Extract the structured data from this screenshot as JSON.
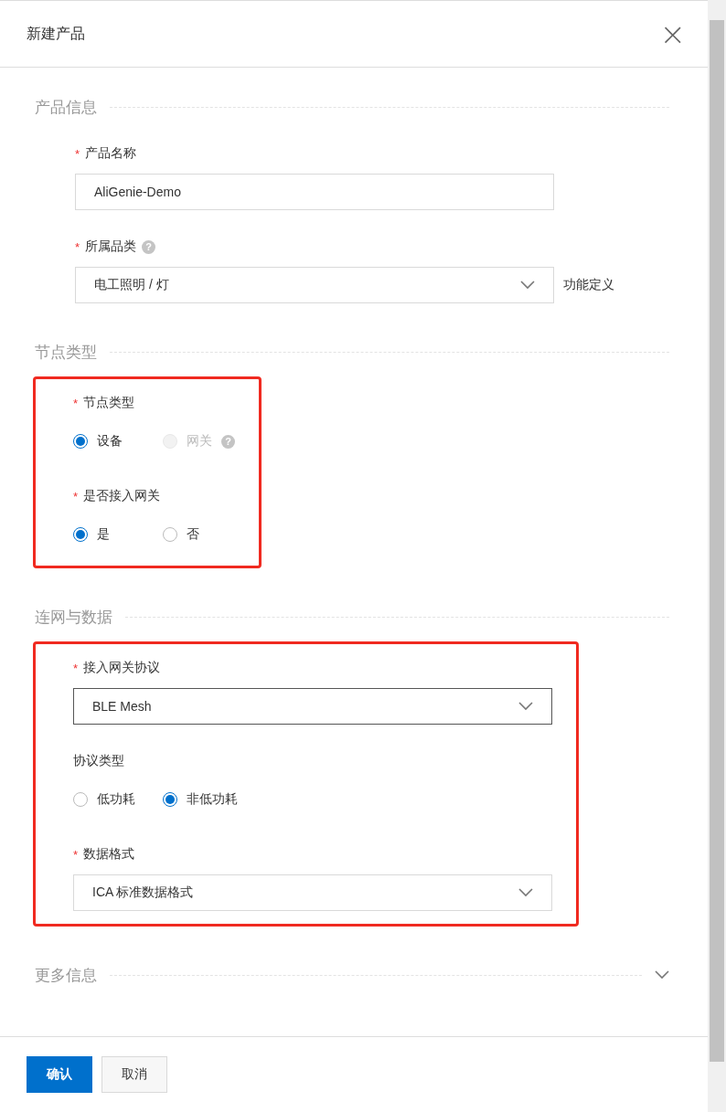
{
  "dialog": {
    "title": "新建产品",
    "close": "×"
  },
  "sections": [
    {
      "title": "产品信息",
      "kind": "group",
      "groups": [
        {
          "highlighted": false,
          "fields": [
            {
              "kind": "input",
              "label": "产品名称",
              "required_mark": "*",
              "value": "AliGenie-Demo"
            },
            {
              "kind": "select",
              "label": "所属品类",
              "required_mark": "*",
              "help": "?",
              "value": "电工照明 / 灯",
              "active": false,
              "link": "功能定义"
            }
          ]
        }
      ]
    },
    {
      "title": "节点类型",
      "kind": "group",
      "groups": [
        {
          "highlighted": true,
          "fields": [
            {
              "kind": "radio",
              "label": "节点类型",
              "required_mark": "*",
              "options": [
                {
                  "label": "设备",
                  "selected": true,
                  "disabled": false
                },
                {
                  "label": "网关",
                  "selected": false,
                  "disabled": true,
                  "help": "?"
                }
              ]
            },
            {
              "kind": "radio",
              "label": "是否接入网关",
              "required_mark": "*",
              "options": [
                {
                  "label": "是",
                  "selected": true,
                  "disabled": false
                },
                {
                  "label": "否",
                  "selected": false,
                  "disabled": false
                }
              ]
            }
          ]
        }
      ]
    },
    {
      "title": "连网与数据",
      "kind": "group",
      "groups": [
        {
          "highlighted": true,
          "fields": [
            {
              "kind": "select",
              "label": "接入网关协议",
              "required_mark": "*",
              "value": "BLE Mesh",
              "active": true
            },
            {
              "kind": "radio",
              "label": "协议类型",
              "options": [
                {
                  "label": "低功耗",
                  "selected": false,
                  "disabled": false
                },
                {
                  "label": "非低功耗",
                  "selected": true,
                  "disabled": false
                }
              ]
            },
            {
              "kind": "select",
              "label": "数据格式",
              "required_mark": "*",
              "value": "ICA 标准数据格式",
              "active": false
            }
          ]
        }
      ]
    },
    {
      "title": "更多信息",
      "kind": "collapsed"
    }
  ],
  "footer": {
    "buttons": [
      {
        "label": "确认",
        "kind": "primary"
      },
      {
        "label": "取消",
        "kind": "secondary"
      }
    ]
  }
}
